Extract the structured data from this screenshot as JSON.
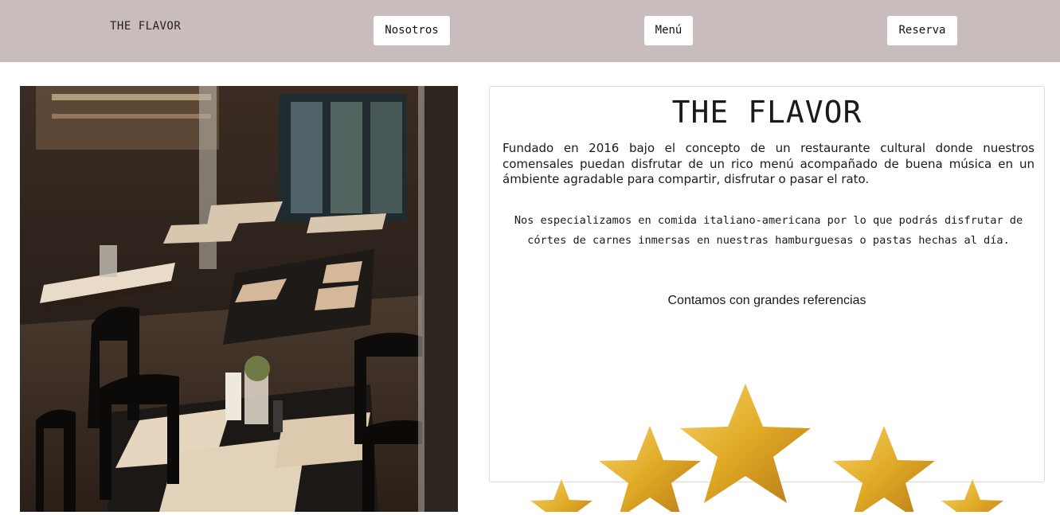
{
  "header": {
    "brand": "THE FLAVOR",
    "nav": {
      "nosotros": "Nosotros",
      "menu": "Menú",
      "reserva": "Reserva"
    }
  },
  "main": {
    "photo_icon": "restaurant-interior-photo",
    "card": {
      "title": "THE FLAVOR",
      "paragraph1": "Fundado en 2016 bajo el concepto de un restaurante cultural donde nuestros comensales puedan disfrutar de un rico menú acompañado de buena música en un ámbiente agradable para compartir, disfrutar o pasar el rato.",
      "paragraph2": "Nos especializamos en comida italiano-americana por lo que podrás disfrutar de córtes de carnes inmersas en nuestras hamburguesas o pastas hechas al día.",
      "paragraph3": "Contamos con grandes referencias",
      "rating_stars": 5
    }
  },
  "colors": {
    "header_bg": "#c8bcbc",
    "star_gold": "#e0a924"
  }
}
